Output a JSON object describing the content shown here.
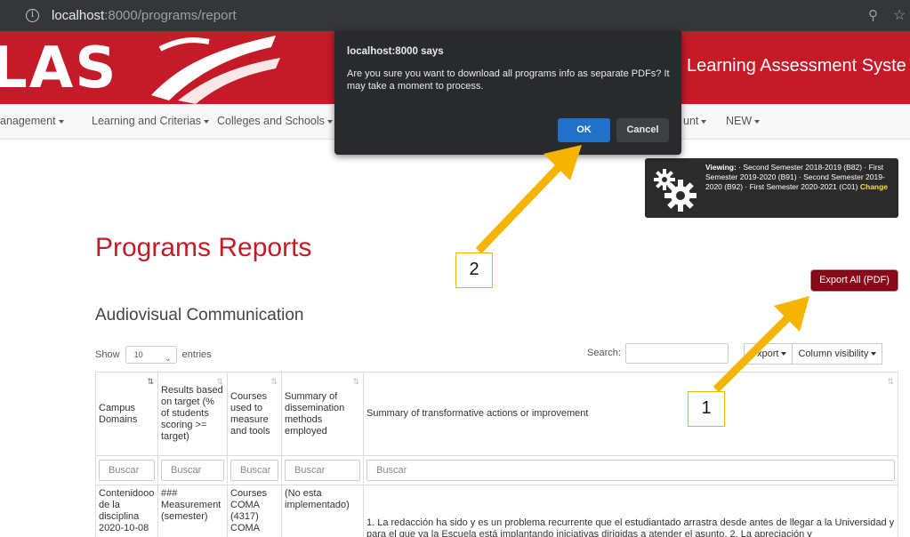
{
  "browser": {
    "url_host": "localhost",
    "url_rest": ":8000/programs/report"
  },
  "banner": {
    "logo_text": "LAS",
    "system_title": "Learning Assessment Syste"
  },
  "nav": {
    "items": [
      {
        "label": "anagement"
      },
      {
        "label": "Learning and Criterias"
      },
      {
        "label": "Colleges and Schools"
      },
      {
        "label": "unt"
      },
      {
        "label": "NEW"
      }
    ]
  },
  "viewing": {
    "label": "Viewing:",
    "text": " · Second Semester 2018-2019 (B82) · First Semester 2019-2020 (B91) · Second Semester 2019-2020 (B92) · First Semester 2020-2021 (C01) ",
    "change_label": "Change"
  },
  "page": {
    "title": "Programs Reports",
    "section_title": "Audiovisual Communication",
    "export_all_label": "Export All (PDF)"
  },
  "table_controls": {
    "show_label": "Show",
    "entries_value": "10",
    "entries_label": "entries",
    "search_label": "Search:",
    "export_label": "xport",
    "column_visibility_label": "Column visibility"
  },
  "table": {
    "headers": [
      "Campus Domains",
      "Results based on target (% of students scoring >= target)",
      "Courses used to measure and tools",
      "Summary of dissemination methods employed",
      "Summary of transformative actions or improvement"
    ],
    "filter_placeholder": "Buscar",
    "rows": [
      [
        "Contenidooo de la disciplina 2020-10-08",
        "### Measurement (semester)",
        "Courses COMA (4317) COMA",
        "(No esta implementado)",
        "1. La redacción ha sido y es un problema recurrente que el estudiantado arrastra desde antes de llegar a la Universidad y para el que va la Escuela está implantando iniciativas dirigidas a atender el asunto. 2. La apreciación y"
      ]
    ]
  },
  "dialog": {
    "title": "localhost:8000 says",
    "message": "Are you sure you want to download all programs info as separate PDFs?  It may take a moment to process.",
    "ok_label": "OK",
    "cancel_label": "Cancel"
  },
  "callouts": {
    "first": "1",
    "second": "2",
    "color": "#f5b400"
  }
}
